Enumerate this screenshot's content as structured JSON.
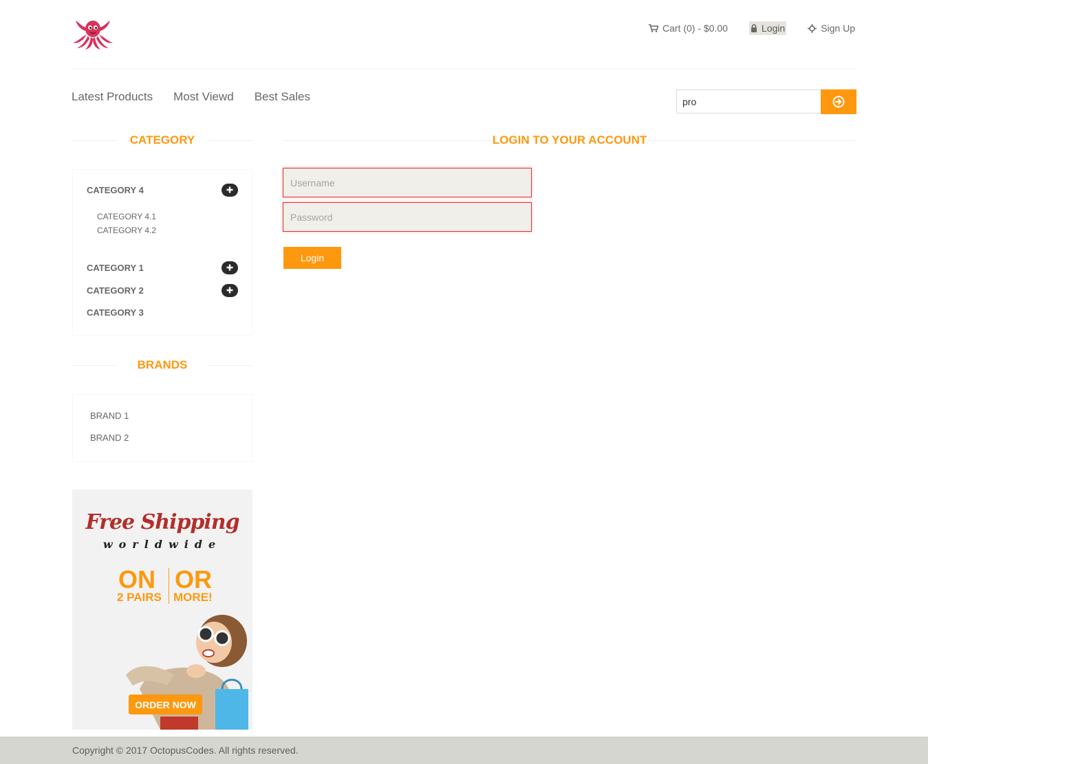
{
  "header": {
    "logo": "octopus-logo",
    "links": [
      {
        "label": "Cart (0) - $0.00",
        "icon": "cart-icon"
      },
      {
        "label": "Login",
        "icon": "lock-icon"
      },
      {
        "label": "Sign Up",
        "icon": "crosshair-icon"
      }
    ]
  },
  "nav": {
    "items": [
      "Latest Products",
      "Most Viewd",
      "Best Sales"
    ]
  },
  "search": {
    "value": "pro",
    "button_icon": "arrow-circle-right-icon"
  },
  "sidebar": {
    "category_title": "CATEGORY",
    "categories": [
      {
        "label": "CATEGORY 4",
        "expandable": true,
        "children": [
          "CATEGORY 4.1",
          "CATEGORY 4.2"
        ]
      },
      {
        "label": "CATEGORY 1",
        "expandable": true
      },
      {
        "label": "CATEGORY 2",
        "expandable": true
      },
      {
        "label": "CATEGORY 3",
        "expandable": false
      }
    ],
    "brands_title": "BRANDS",
    "brands": [
      "BRAND 1",
      "BRAND 2"
    ]
  },
  "ad": {
    "headline": "Free Shipping",
    "subline": "worldwide",
    "left_big": "ON",
    "left_small": "2 PAIRS",
    "right_big": "OR",
    "right_small": "MORE!",
    "cta": "ORDER NOW"
  },
  "login": {
    "title": "LOGIN TO YOUR ACCOUNT",
    "username_placeholder": "Username",
    "password_placeholder": "Password",
    "button": "Login"
  },
  "footer": {
    "copyright": "Copyright © 2017 OctopusCodes. All rights reserved."
  },
  "colors": {
    "accent": "#fe980f",
    "error_border": "#e6302c",
    "footer_bg": "#d6d6d0",
    "ad_headline": "#b22f2c"
  }
}
